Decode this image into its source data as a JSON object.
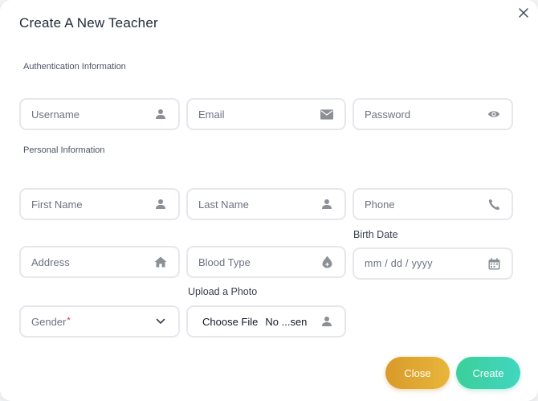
{
  "modal": {
    "title": "Create A New Teacher",
    "close_icon": "close-icon"
  },
  "sections": {
    "auth": "Authentication Information",
    "personal": "Personal Information"
  },
  "fields": {
    "username": {
      "placeholder": "Username",
      "icon": "user-icon"
    },
    "email": {
      "placeholder": "Email",
      "icon": "envelope-icon"
    },
    "password": {
      "placeholder": "Password",
      "icon": "eye-icon"
    },
    "first_name": {
      "placeholder": "First Name",
      "icon": "user-icon"
    },
    "last_name": {
      "placeholder": "Last Name",
      "icon": "user-icon"
    },
    "phone": {
      "placeholder": "Phone",
      "icon": "phone-icon"
    },
    "address": {
      "placeholder": "Address",
      "icon": "home-icon"
    },
    "blood_type": {
      "placeholder": "Blood Type",
      "icon": "blood-drop-icon"
    },
    "birth_date": {
      "label": "Birth Date",
      "placeholder": "mm / dd / yyyy",
      "icon": "calendar-icon"
    },
    "gender": {
      "placeholder": "Gender",
      "required_mark": "*",
      "icon": "chevron-down-icon"
    },
    "photo": {
      "label": "Upload a Photo",
      "button": "Choose File",
      "status": "No ...sen",
      "icon": "user-icon"
    }
  },
  "actions": {
    "close": "Close",
    "create": "Create"
  },
  "colors": {
    "close_button": "#e0a830",
    "create_button": "#3ed3ac"
  }
}
